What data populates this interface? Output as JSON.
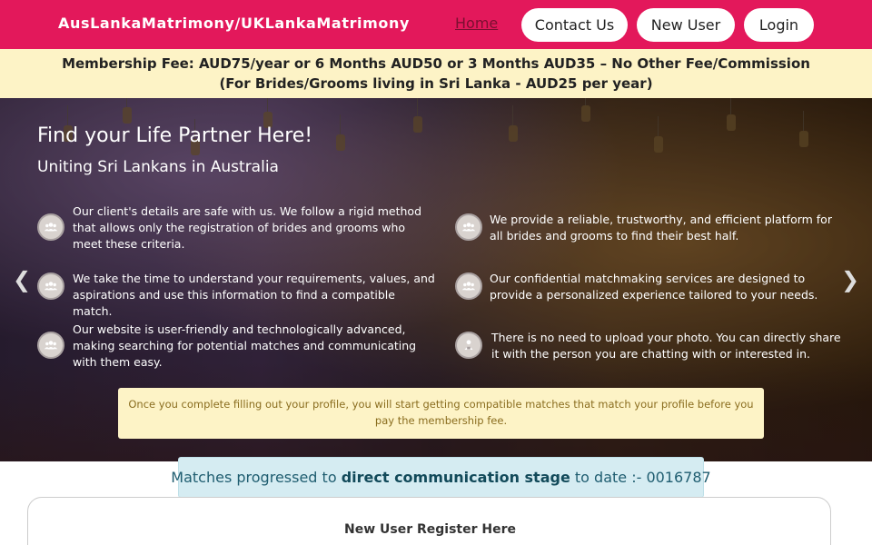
{
  "navbar": {
    "brand": "AusLankaMatrimony/UKLankaMatrimony",
    "home": "Home",
    "contact": "Contact Us",
    "new_user": "New User",
    "login": "Login",
    "bg_color": "#e3185b"
  },
  "fee_banner": {
    "line1": "Membership Fee: AUD75/year or 6 Months AUD50 or 3 Months AUD35 – No Other Fee/Commission",
    "line2": "(For Brides/Grooms living in Sri Lanka - AUD25 per year)",
    "bg_color": "#fdf3c6"
  },
  "hero": {
    "title": "Find your Life Partner Here!",
    "subtitle": "Uniting Sri Lankans in Australia",
    "features": [
      {
        "icon": "users-icon",
        "text": "Our client's details are safe with us. We follow a rigid method that allows only the registration of brides and grooms who meet these criteria."
      },
      {
        "icon": "users-icon",
        "text": "We provide a reliable, trustworthy, and efficient platform for all brides and grooms to find their best half."
      },
      {
        "icon": "users-icon",
        "text": "We take the time to understand your requirements, values, and aspirations and use this information to find a compatible match."
      },
      {
        "icon": "users-icon",
        "text": "Our confidential matchmaking services are designed to provide a personalized experience tailored to your needs."
      },
      {
        "icon": "users-icon",
        "text": "Our website is user-friendly and technologically advanced, making searching for potential matches and communicating with them easy."
      },
      {
        "icon": "user-lock-icon",
        "text": "There is no need to upload your photo. You can directly share it with the person you are chatting with or interested in."
      }
    ],
    "prev_icon": "chevron-left-icon",
    "next_icon": "chevron-right-icon",
    "notice": "Once you complete filling out your profile, you will start getting compatible matches that match your profile before you pay the membership fee."
  },
  "matches": {
    "prefix": "Matches progressed to ",
    "strong": "direct communication stage",
    "suffix": " to date :- 0016787"
  },
  "register": {
    "title": "New User Register Here"
  }
}
